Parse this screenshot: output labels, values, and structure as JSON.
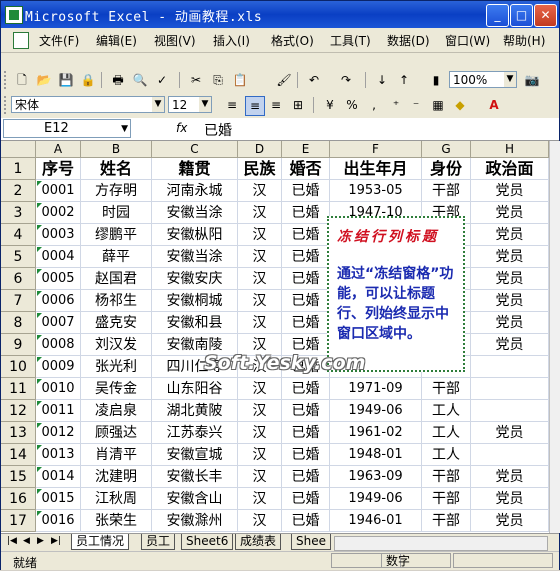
{
  "window": {
    "title": "Microsoft Excel - 动画教程.xls"
  },
  "menubar": {
    "items": [
      "文件(F)",
      "编辑(E)",
      "视图(V)",
      "插入(I)",
      "格式(O)",
      "工具(T)",
      "数据(D)",
      "窗口(W)",
      "帮助(H)"
    ]
  },
  "toolbar": {
    "zoom": "100%",
    "font_name": "宋体",
    "font_size": "12"
  },
  "formula_bar": {
    "cell_ref": "E12",
    "fx": "fx",
    "value": "已婚"
  },
  "grid": {
    "columns": [
      "A",
      "B",
      "C",
      "D",
      "E",
      "F",
      "G",
      "H"
    ],
    "row_numbers": [
      "1",
      "2",
      "3",
      "4",
      "5",
      "6",
      "7",
      "8",
      "9",
      "10",
      "11",
      "12",
      "13",
      "14",
      "15",
      "16",
      "17"
    ],
    "header": [
      "序号",
      "姓名",
      "籍贯",
      "民族",
      "婚否",
      "出生年月",
      "身份",
      "政治面"
    ],
    "rows": [
      [
        "0001",
        "方存明",
        "河南永城",
        "汉",
        "已婚",
        "1953-05",
        "干部",
        "党员"
      ],
      [
        "0002",
        "时园",
        "安徽当涂",
        "汉",
        "已婚",
        "1947-10",
        "干部",
        "党员"
      ],
      [
        "0003",
        "缪鹏平",
        "安徽枞阳",
        "汉",
        "已婚",
        "",
        "",
        "党员"
      ],
      [
        "0004",
        "薛平",
        "安徽当涂",
        "汉",
        "已婚",
        "",
        "",
        "党员"
      ],
      [
        "0005",
        "赵国君",
        "安徽安庆",
        "汉",
        "已婚",
        "",
        "",
        "党员"
      ],
      [
        "0006",
        "杨祁生",
        "安徽桐城",
        "汉",
        "已婚",
        "",
        "",
        "党员"
      ],
      [
        "0007",
        "盛克安",
        "安徽和县",
        "汉",
        "已婚",
        "",
        "",
        "党员"
      ],
      [
        "0008",
        "刘汉发",
        "安徽南陵",
        "汉",
        "已婚",
        "",
        "",
        "党员"
      ],
      [
        "0009",
        "张光利",
        "四川仁寿",
        "汉",
        "已婚",
        "",
        "",
        ""
      ],
      [
        "0010",
        "吴传金",
        "山东阳谷",
        "汉",
        "已婚",
        "1971-09",
        "干部",
        ""
      ],
      [
        "0011",
        "凌启泉",
        "湖北黄陂",
        "汉",
        "已婚",
        "1949-06",
        "工人",
        ""
      ],
      [
        "0012",
        "顾强达",
        "江苏泰兴",
        "汉",
        "已婚",
        "1961-02",
        "工人",
        "党员"
      ],
      [
        "0013",
        "肖清平",
        "安徽宣城",
        "汉",
        "已婚",
        "1948-01",
        "工人",
        ""
      ],
      [
        "0014",
        "沈建明",
        "安徽长丰",
        "汉",
        "已婚",
        "1963-09",
        "干部",
        "党员"
      ],
      [
        "0015",
        "江秋周",
        "安徽含山",
        "汉",
        "已婚",
        "1949-06",
        "干部",
        "党员"
      ],
      [
        "0016",
        "张荣生",
        "安徽滁州",
        "汉",
        "已婚",
        "1946-01",
        "干部",
        "党员"
      ]
    ]
  },
  "note": {
    "title": "冻结行列标题",
    "body": "通过“冻结窗格”功能，可以让标题行、列始终显示中窗口区域中。"
  },
  "watermark": "Soft.Yesky.com",
  "sheet_tabs": [
    "员工情况",
    "员工",
    "Sheet6",
    "成绩表",
    "Shee"
  ],
  "status": {
    "left": "就绪",
    "mode": "数字"
  }
}
